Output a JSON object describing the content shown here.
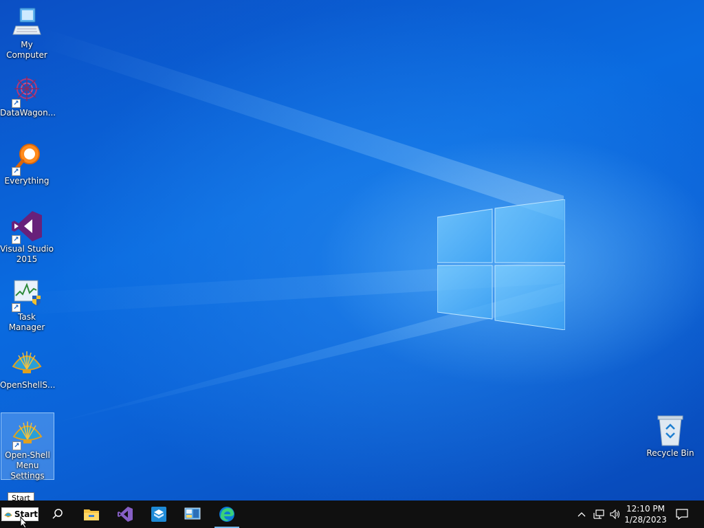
{
  "desktop": {
    "icons": [
      {
        "label": "My Computer",
        "icon": "computer-icon",
        "shortcut": false
      },
      {
        "label": "DataWagon...",
        "icon": "datawagon-icon",
        "shortcut": true
      },
      {
        "label": "Everything",
        "icon": "everything-search-icon",
        "shortcut": true
      },
      {
        "label": "Visual Studio 2015",
        "icon": "visual-studio-icon",
        "shortcut": true
      },
      {
        "label": "Task Manager",
        "icon": "task-manager-icon",
        "shortcut": true
      },
      {
        "label": "OpenShellS...",
        "icon": "open-shell-icon",
        "shortcut": false
      },
      {
        "label": "Open-Shell Menu Settings",
        "icon": "open-shell-icon",
        "shortcut": true,
        "selected": true
      }
    ],
    "recycle_bin": {
      "label": "Recycle Bin",
      "icon": "recycle-bin-icon"
    }
  },
  "taskbar": {
    "start_label": "Start",
    "start_tooltip": "Start",
    "pinned": [
      {
        "name": "search",
        "icon": "search-icon"
      },
      {
        "name": "file-explorer",
        "icon": "folder-icon"
      },
      {
        "name": "visual-studio",
        "icon": "visual-studio-icon"
      },
      {
        "name": "app-box",
        "icon": "box-app-icon"
      },
      {
        "name": "control-panel",
        "icon": "control-panel-icon"
      },
      {
        "name": "edge",
        "icon": "edge-icon",
        "active": true
      }
    ],
    "tray": {
      "time": "12:10 PM",
      "date": "1/28/2023"
    }
  },
  "colors": {
    "desktop_blue": "#0a5fd8",
    "taskbar": "#101010",
    "active_indicator": "#76b9ed"
  }
}
